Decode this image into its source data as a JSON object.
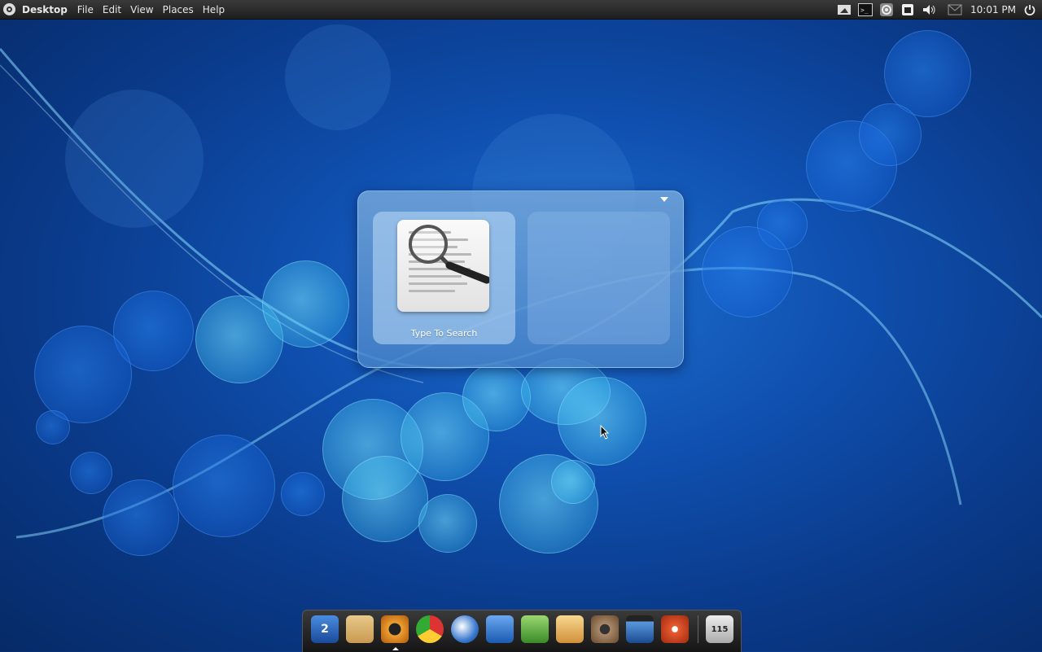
{
  "top_panel": {
    "title": "Desktop",
    "menu": [
      "File",
      "Edit",
      "View",
      "Places",
      "Help"
    ],
    "tray_icons": [
      "screenshot-icon",
      "terminal-icon",
      "settings-icon",
      "window-icon",
      "volume-icon",
      "mail-icon"
    ],
    "clock": "10:01 PM",
    "power_icon": "power-icon"
  },
  "launcher": {
    "tiles": [
      {
        "label": "Type To Search",
        "icon": "search-document-icon"
      },
      {
        "label": "",
        "icon": ""
      }
    ],
    "dropdown_icon": "triangle-down-icon"
  },
  "dock": {
    "items": [
      {
        "name": "workspace-switcher",
        "badge": "2",
        "color": "#2a6cc8"
      },
      {
        "name": "file-manager",
        "color": "#d6b06a"
      },
      {
        "name": "camera-app",
        "color": "#e0882a"
      },
      {
        "name": "chrome-browser",
        "color": "#3a9a3a"
      },
      {
        "name": "earth-browser",
        "color": "#2a5db0"
      },
      {
        "name": "writer-document",
        "color": "#3a74c0"
      },
      {
        "name": "calc-spreadsheet",
        "color": "#5aa840"
      },
      {
        "name": "paint-app",
        "color": "#e0b060"
      },
      {
        "name": "media-speaker",
        "color": "#8a6a50"
      },
      {
        "name": "video-player",
        "color": "#3a6aa0"
      },
      {
        "name": "music-player",
        "color": "#d04a28"
      },
      {
        "name": "phone-dialer",
        "badge": "115",
        "color": "#cfcfcf"
      }
    ]
  }
}
